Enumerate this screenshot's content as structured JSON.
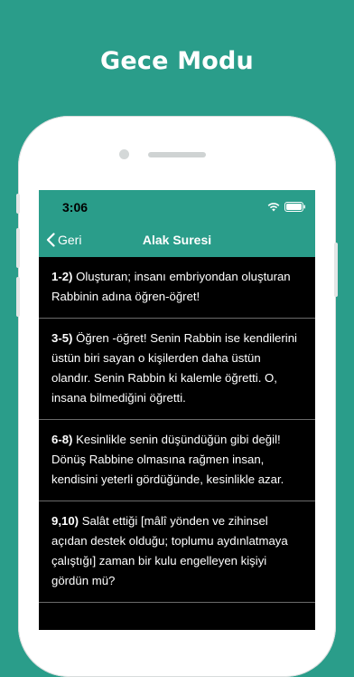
{
  "promo": {
    "title": "Gece Modu"
  },
  "status_bar": {
    "time": "3:06"
  },
  "nav": {
    "back_label": "Geri",
    "title": "Alak Suresi"
  },
  "verses": [
    {
      "num": "1-2)",
      "text": " Oluşturan; insanı embriyondan oluşturan Rabbinin adına öğren-öğret!"
    },
    {
      "num": "3-5)",
      "text": " Öğren -öğret! Senin Rabbin ise kendilerini üstün biri sayan o kişilerden daha üstün olandır. Senin Rabbin ki kalemle öğretti. O, insana bilmediğini öğretti."
    },
    {
      "num": "6-8)",
      "text": " Kesinlikle senin düşündüğün gibi değil! Dönüş Rabbine olmasına rağmen insan, kendisini yeterli gördüğünde, kesinlikle azar."
    },
    {
      "num": "9,10)",
      "text": " Salât ettiği [mâlî yönden ve zihinsel açıdan destek olduğu; toplumu aydınlatmaya çalıştığı] zaman bir kulu engelleyen kişiyi gördün mü?"
    }
  ],
  "colors": {
    "accent": "#2a9d8a",
    "screen_bg": "#000000",
    "divider": "#6a6a6a"
  },
  "icons": {
    "back": "chevron-left-icon",
    "wifi": "wifi-icon",
    "battery": "battery-icon"
  }
}
